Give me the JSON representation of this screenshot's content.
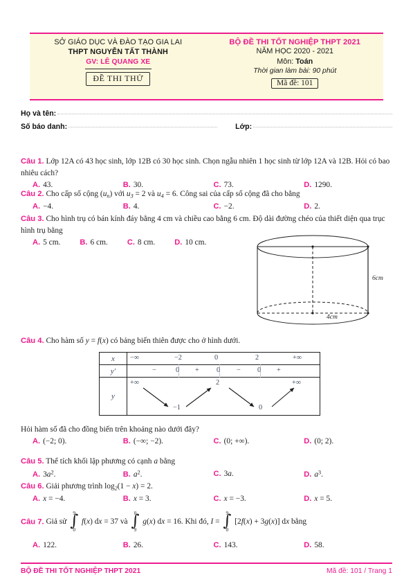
{
  "header": {
    "left": {
      "line1": "SỞ GIÁO DỤC VÀ ĐÀO TẠO GIA LAI",
      "line2": "THPT NGUYỄN TẤT THÀNH",
      "line3": "GV: LÊ QUANG XE",
      "badge": "ĐỀ THI THỬ"
    },
    "right": {
      "title": "BỘ ĐỀ THI TỐT NGHIỆP THPT 2021",
      "year": "NĂM HỌC 2020 - 2021",
      "subject_label": "Môn: ",
      "subject": "Toán",
      "duration": "Thời gian làm bài: 90 phút",
      "code": "Mã đề: 101"
    }
  },
  "identity": {
    "name_label": "Họ và tên:",
    "sbd_label": "Số báo danh:",
    "class_label": "Lớp:"
  },
  "questions": [
    {
      "label": "Câu 1.",
      "text": "Lớp 12A có 43 học sinh, lớp 12B có 30 học sinh. Chọn ngẫu nhiên 1 học sinh từ lớp 12A và 12B. Hỏi có bao nhiêu cách?",
      "choices": [
        {
          "key": "A.",
          "value": "43."
        },
        {
          "key": "B.",
          "value": "30."
        },
        {
          "key": "C.",
          "value": "73."
        },
        {
          "key": "D.",
          "value": "1290."
        }
      ]
    },
    {
      "label": "Câu 2.",
      "choices": [
        {
          "key": "A.",
          "value": "−4."
        },
        {
          "key": "B.",
          "value": "4."
        },
        {
          "key": "C.",
          "value": "−2."
        },
        {
          "key": "D.",
          "value": "2."
        }
      ]
    },
    {
      "label": "Câu 3.",
      "text": "Cho hình trụ có bán kính đáy bằng 4 cm và chiều cao bằng 6 cm. Độ dài đường chéo của thiết diện qua trục hình trụ bằng",
      "choices": [
        {
          "key": "A.",
          "value": "5 cm."
        },
        {
          "key": "B.",
          "value": "6 cm."
        },
        {
          "key": "C.",
          "value": "8 cm."
        },
        {
          "key": "D.",
          "value": "10 cm."
        }
      ]
    },
    {
      "label": "Câu 4.",
      "question_tail": "Hỏi hàm số đã cho đồng biến trên khoảng nào dưới đây?",
      "choices": [
        {
          "key": "A.",
          "value": "(−2; 0)."
        },
        {
          "key": "B.",
          "value": "(−∞; −2)."
        },
        {
          "key": "C.",
          "value": "(0; +∞)."
        },
        {
          "key": "D.",
          "value": "(0; 2)."
        }
      ]
    },
    {
      "label": "Câu 5.",
      "text": "Thể tích khối lập phương có cạnh a bằng",
      "choices": [
        {
          "key": "A.",
          "value": "3a²."
        },
        {
          "key": "B.",
          "value": "a²."
        },
        {
          "key": "C.",
          "value": "3a."
        },
        {
          "key": "D.",
          "value": "a³."
        }
      ]
    },
    {
      "label": "Câu 6.",
      "choices": [
        {
          "key": "A.",
          "value": "x = −4."
        },
        {
          "key": "B.",
          "value": "x = 3."
        },
        {
          "key": "C.",
          "value": "x = −3."
        },
        {
          "key": "D.",
          "value": "x = 5."
        }
      ]
    },
    {
      "label": "Câu 7.",
      "choices": [
        {
          "key": "A.",
          "value": "122."
        },
        {
          "key": "B.",
          "value": "26."
        },
        {
          "key": "C.",
          "value": "143."
        },
        {
          "key": "D.",
          "value": "58."
        }
      ]
    }
  ],
  "cylinder": {
    "height_label": "6cm",
    "radius_label": "4cm"
  },
  "chart_data": {
    "type": "table",
    "title": "Bảng biến thiên",
    "rows": [
      "x",
      "y'",
      "y"
    ],
    "x_values": [
      "−∞",
      "−2",
      "0",
      "2",
      "+∞"
    ],
    "yprime_signs": [
      "−",
      "0",
      "+",
      "0",
      "−",
      "0",
      "+"
    ],
    "y_values": [
      "+∞",
      "−1",
      "2",
      "0",
      "+∞"
    ],
    "y_directions": [
      "down",
      "up",
      "down",
      "up"
    ]
  },
  "footer": {
    "left": "BỘ ĐỀ THI TỐT NGHIỆP THPT 2021",
    "right": "Mã đề: 101 / Trang 1"
  },
  "colors": {
    "accent": "#ec1c8e",
    "header_bg": "#fcf8dd",
    "text": "#1d1d1d",
    "table_text": "#3d4a5c"
  }
}
